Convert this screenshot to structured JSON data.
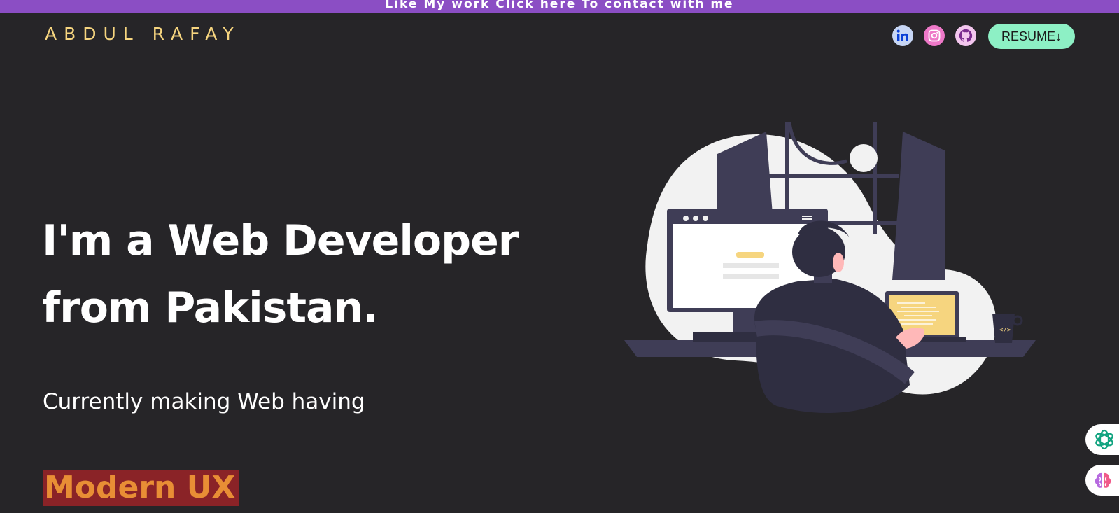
{
  "banner": {
    "text": "Like My work Click here To contact with me"
  },
  "header": {
    "brand": "ABDUL RAFAY",
    "resume_label": "RESUME↓",
    "socials": [
      {
        "icon": "linkedin-icon",
        "color": "#0a66c2"
      },
      {
        "icon": "instagram-icon",
        "color": "#d6249f"
      },
      {
        "icon": "github-icon",
        "color": "#6e2b8a"
      }
    ]
  },
  "hero": {
    "headline_line1": "I'm a Web Developer",
    "headline_line2": "from Pakistan.",
    "subtitle": "Currently making Web having",
    "highlight": "Modern UX"
  },
  "colors": {
    "background": "#262528",
    "banner": "#8b4ec4",
    "brand": "#f6d57f",
    "resume_button": "#8df0c5",
    "highlight_bg": "#8a2327",
    "highlight_text": "#e88e35"
  },
  "floating": [
    {
      "icon": "chatgpt-icon"
    },
    {
      "icon": "brain-icon"
    }
  ]
}
